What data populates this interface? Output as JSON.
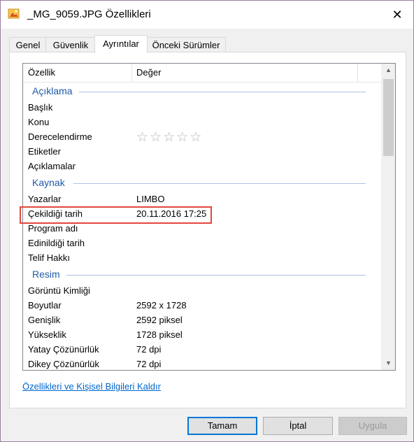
{
  "window": {
    "title": "_MG_9059.JPG Özellikleri",
    "close_glyph": "✕"
  },
  "tabs": [
    {
      "label": "Genel",
      "active": false
    },
    {
      "label": "Güvenlik",
      "active": false
    },
    {
      "label": "Ayrıntılar",
      "active": true
    },
    {
      "label": "Önceki Sürümler",
      "active": false
    }
  ],
  "list": {
    "columns": {
      "property": "Özellik",
      "value": "Değer"
    },
    "groups": [
      {
        "name": "Açıklama",
        "rows": [
          {
            "name": "Başlık",
            "value": ""
          },
          {
            "name": "Konu",
            "value": ""
          },
          {
            "name": "Derecelendirme",
            "value": "",
            "rating": 0,
            "rating_max": 5
          },
          {
            "name": "Etiketler",
            "value": ""
          },
          {
            "name": "Açıklamalar",
            "value": ""
          }
        ]
      },
      {
        "name": "Kaynak",
        "rows": [
          {
            "name": "Yazarlar",
            "value": "LIMBO"
          },
          {
            "name": "Çekildiği tarih",
            "value": "20.11.2016 17:25"
          },
          {
            "name": "Program adı",
            "value": ""
          },
          {
            "name": "Edinildiği tarih",
            "value": ""
          },
          {
            "name": "Telif Hakkı",
            "value": ""
          }
        ]
      },
      {
        "name": "Resim",
        "rows": [
          {
            "name": "Görüntü Kimliği",
            "value": ""
          },
          {
            "name": "Boyutlar",
            "value": "2592 x 1728"
          },
          {
            "name": "Genişlik",
            "value": "2592 piksel"
          },
          {
            "name": "Yükseklik",
            "value": "1728 piksel"
          },
          {
            "name": "Yatay Çözünürlük",
            "value": "72 dpi"
          },
          {
            "name": "Dikey Çözünürlük",
            "value": "72 dpi"
          }
        ]
      }
    ]
  },
  "remove_link": "Özellikleri ve Kişisel Bilgileri Kaldır",
  "buttons": {
    "ok": "Tamam",
    "cancel": "İptal",
    "apply": "Uygula"
  },
  "colors": {
    "accent": "#0078d7",
    "group_header": "#1e5aa8",
    "highlight_box": "#e0483f",
    "link": "#0066cc"
  },
  "icons": {
    "app": "image-file-icon",
    "close": "close-icon",
    "star": "star-icon",
    "scroll_up": "chevron-up-icon",
    "scroll_down": "chevron-down-icon"
  }
}
